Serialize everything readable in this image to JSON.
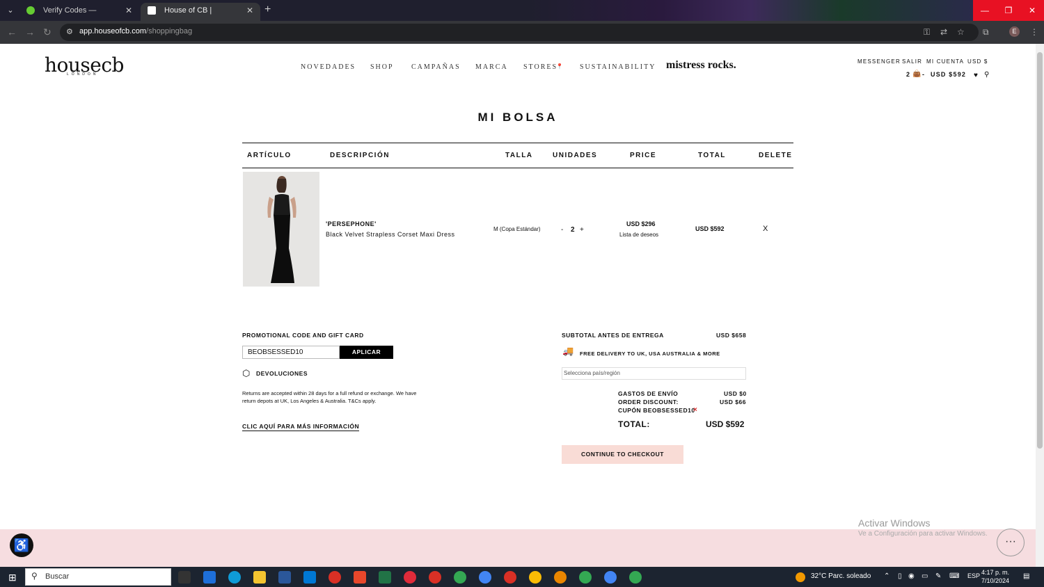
{
  "browser": {
    "tabs": [
      {
        "title": "Verify Codes — SimplyCodes",
        "active": false
      },
      {
        "title": "House of CB | Womenswear de",
        "active": true
      }
    ],
    "url_host": "app.houseofcb.com",
    "url_path": "/shoppingbag",
    "profile_initial": "E"
  },
  "site": {
    "logo": "housecb",
    "logo_sub": "LONDON",
    "nav": [
      "NOVEDADES",
      "SHOP",
      "CAMPAÑAS",
      "MARCA",
      "STORES",
      "SUSTAINABILITY"
    ],
    "mistress": "mistress rocks.",
    "top_links": [
      "MESSENGER",
      "SALIR",
      "MI CUENTA",
      "USD $"
    ],
    "cart_count": "2",
    "cart_sep": "-",
    "cart_total": "USD $592"
  },
  "bag": {
    "title": "MI BOLSA",
    "headers": {
      "article": "ARTÍCULO",
      "description": "DESCRIPCIÓN",
      "size": "TALLA",
      "units": "UNIDADES",
      "price": "PRICE",
      "total": "TOTAL",
      "delete": "DELETE"
    },
    "item": {
      "name": "'PERSEPHONE'",
      "desc": "Black Velvet Strapless Corset Maxi Dress",
      "size": "M (Copa Estándar)",
      "qty_minus": "-",
      "qty": "2",
      "qty_plus": "+",
      "price": "USD $296",
      "wishlist": "Lista de deseos",
      "total": "USD $592",
      "delete": "X"
    }
  },
  "promo": {
    "label": "PROMOTIONAL CODE AND GIFT CARD",
    "value": "BEOBSESSED10",
    "apply": "APLICAR",
    "returns_label": "DEVOLUCIONES",
    "returns_text": "Returns are accepted within 28 days for a full refund or exchange. We have return depots at UK, Los Angeles & Australia. T&Cs apply.",
    "more_info": "CLIC AQUÍ PARA MÁS INFORMACIÓN"
  },
  "summary": {
    "subtotal_label": "SUBTOTAL ANTES DE ENTREGA",
    "subtotal_value": "USD $658",
    "free_delivery": "FREE DELIVERY TO UK, USA AUSTRALIA & MORE",
    "country_placeholder": "Selecciona país/región",
    "shipping_label": "GASTOS DE ENVÍO",
    "shipping_value": "USD $0",
    "discount_label": "ORDER DISCOUNT:",
    "discount_value": "USD $66",
    "coupon_label": "CUPÓN BEOBSESSED10",
    "coupon_remove": "×",
    "total_label": "TOTAL:",
    "total_value": "USD $592",
    "checkout": "CONTINUE TO CHECKOUT"
  },
  "overlay": {
    "activate": "Activar Windows",
    "activate_sub": "Ve a Configuración para activar Windows."
  },
  "taskbar": {
    "search": "Buscar",
    "weather": "32°C  Parc. soleado",
    "lang": "ESP",
    "time": "4:17 p. m.",
    "date": "7/10/2024"
  },
  "colors": {
    "accent_pink": "#f9dcd6",
    "footer_pink": "#f6dde0",
    "chrome_dark": "#35363a"
  }
}
